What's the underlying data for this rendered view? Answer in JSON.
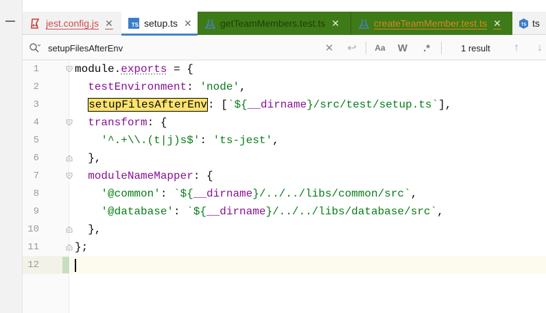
{
  "tabs": [
    {
      "label": "jest.config.js",
      "icon": "jest-icon"
    },
    {
      "label": "setup.ts",
      "icon": "typescript-icon",
      "icon_text": "TS"
    },
    {
      "label": "getTeamMembers.test.ts",
      "icon": "test-flask-icon"
    },
    {
      "label": "createTeamMember.test.ts",
      "icon": "test-flask-icon"
    },
    {
      "label": "ts",
      "icon": "typescript-round-icon"
    }
  ],
  "search": {
    "query": "setupFilesAfterEnv",
    "case_label": "Aa",
    "word_label": "W",
    "regex_label": ".*",
    "result_count": "1 result"
  },
  "editor": {
    "line_numbers": [
      "1",
      "2",
      "3",
      "4",
      "5",
      "6",
      "7",
      "8",
      "9",
      "10",
      "11",
      "12"
    ],
    "lines": {
      "l1": {
        "module": "module",
        "dot": ".",
        "exports": "exports",
        "rest": " = {"
      },
      "l2": {
        "indent": "  ",
        "key": "testEnvironment",
        "colon": ": ",
        "value": "'node'",
        "end": ","
      },
      "l3": {
        "indent": "  ",
        "match": "setupFilesAfterEnv",
        "colon": ": [",
        "t1": "`${",
        "var": "__dirname",
        "t2": "}/src/test/setup.ts`",
        "end": "],"
      },
      "l4": {
        "indent": "  ",
        "key": "transform",
        "rest": ": {"
      },
      "l5": {
        "indent": "    ",
        "value": "'^.+\\\\.(t|j)s$'",
        "colon": ": ",
        "value2": "'ts-jest'",
        "end": ","
      },
      "l6": {
        "text": "  },"
      },
      "l7": {
        "indent": "  ",
        "key": "moduleNameMapper",
        "rest": ": {"
      },
      "l8": {
        "indent": "    ",
        "value": "'@common'",
        "colon": ": ",
        "t1": "`${",
        "var": "__dirname",
        "t2": "}/../../libs/common/src`",
        "end": ","
      },
      "l9": {
        "indent": "    ",
        "value": "'@database'",
        "colon": ": ",
        "t1": "`${",
        "var": "__dirname",
        "t2": "}/../../libs/database/src`",
        "end": ","
      },
      "l10": {
        "text": "  },"
      },
      "l11": {
        "text": "};"
      },
      "l12": {
        "text": ""
      }
    }
  },
  "colors": {
    "test_tab_bg": "#3e7a17",
    "search_highlight": "#fde36e",
    "string": "#067d17",
    "property": "#871094"
  }
}
